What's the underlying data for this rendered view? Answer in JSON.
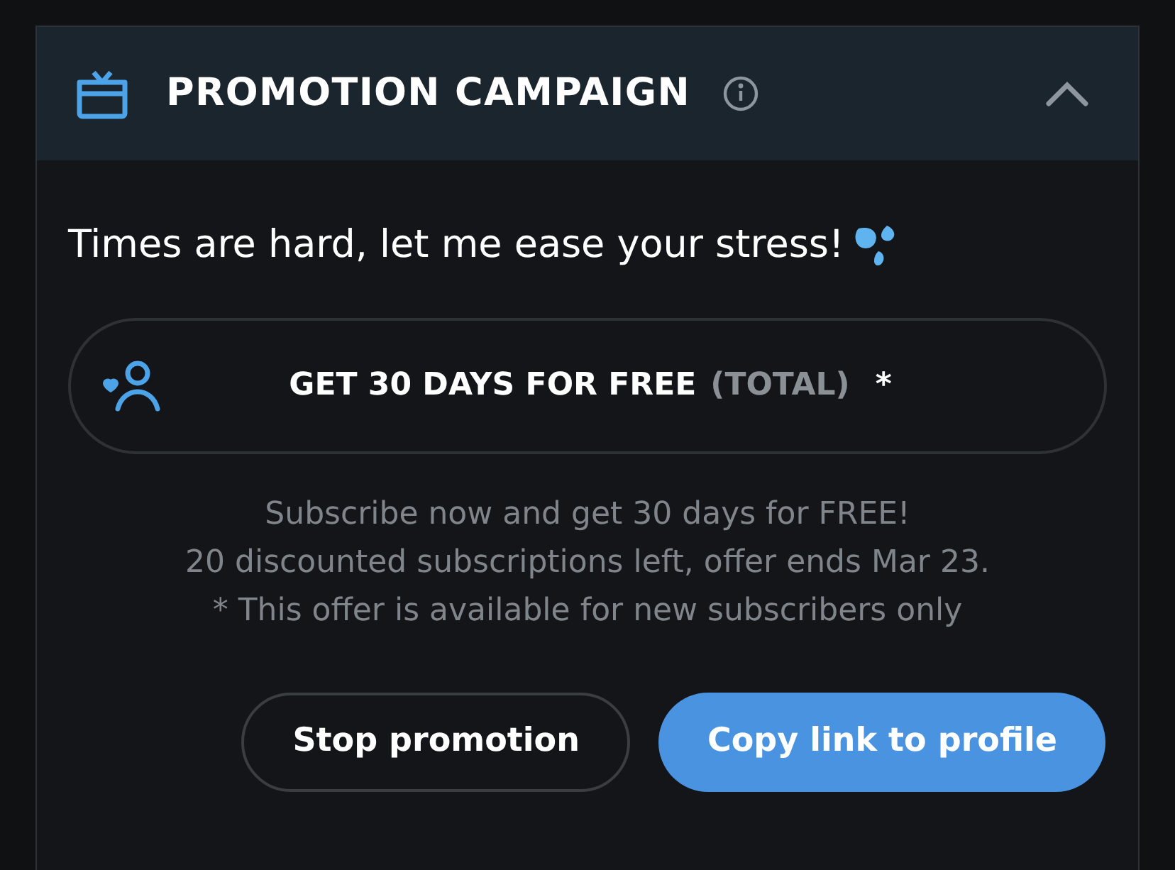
{
  "header": {
    "title": "PROMOTION CAMPAIGN",
    "expanded": true
  },
  "message": "Times are hard, let me ease your stress!",
  "offer": {
    "label": "GET 30 DAYS FOR FREE",
    "qualifier": "(TOTAL)",
    "footnote_mark": "*"
  },
  "details": [
    "Subscribe now and get 30 days for FREE!",
    "20 discounted subscriptions left, offer ends Mar 23.",
    "* This offer is available for new subscribers only"
  ],
  "buttons": [
    {
      "label": "Stop promotion",
      "kind": "outline"
    },
    {
      "label": "Copy link to profile",
      "kind": "primary"
    }
  ]
}
